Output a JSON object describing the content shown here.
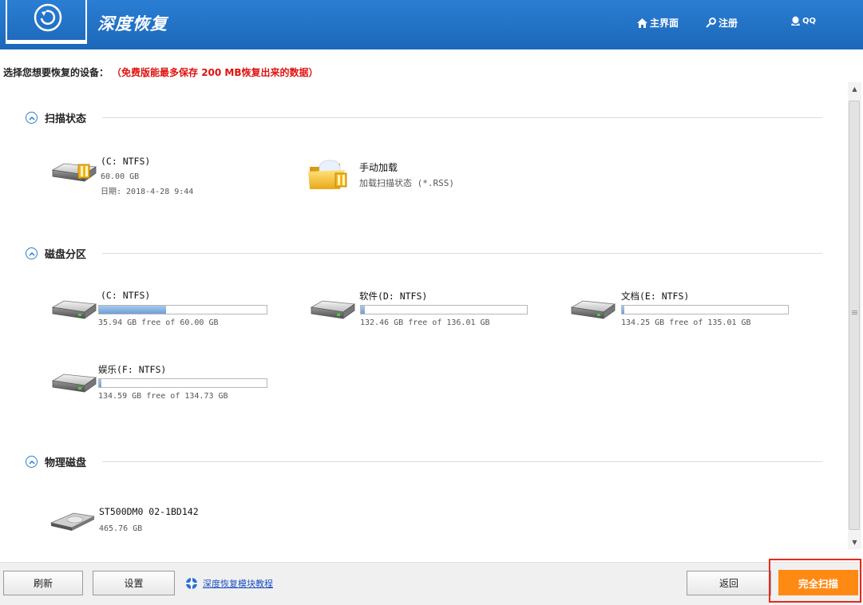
{
  "header": {
    "app_title": "深度恢复",
    "nav": [
      {
        "label": "主界面",
        "icon": "home-icon"
      },
      {
        "label": "注册",
        "icon": "key-icon"
      },
      {
        "label": "QQ",
        "icon": "qq-penguin-icon"
      }
    ]
  },
  "notice": {
    "prompt": "选择您想要恢复的设备：",
    "limit": "（免费版能最多保存 200 MB恢复出来的数据）"
  },
  "sections": {
    "scan_state": {
      "title": "扫描状态",
      "items": [
        {
          "name": "(C: NTFS)",
          "size": "60.00 GB",
          "date": "日期: 2018-4-28 9:44",
          "icon": "hard-drive-lock-icon"
        },
        {
          "name": "手动加载",
          "desc": "加载扫描状态 (*.RSS)",
          "icon": "folder-lock-icon"
        }
      ]
    },
    "partitions": {
      "title": "磁盘分区",
      "items": [
        {
          "name": "(C: NTFS)",
          "free_text": "35.94 GB free of 60.00 GB",
          "used_fraction": 0.401
        },
        {
          "name": "软件(D: NTFS)",
          "free_text": "132.46 GB free of 136.01 GB",
          "used_fraction": 0.026
        },
        {
          "name": "文档(E: NTFS)",
          "free_text": "134.25 GB free of 135.01 GB",
          "used_fraction": 0.006
        },
        {
          "name": "娱乐(F: NTFS)",
          "free_text": "134.59 GB free of 134.73 GB",
          "used_fraction": 0.001
        }
      ]
    },
    "physical": {
      "title": "物理磁盘",
      "items": [
        {
          "name": "ST500DM0 02-1BD142",
          "size": "465.76 GB",
          "icon": "physical-disk-icon"
        }
      ]
    }
  },
  "footer": {
    "refresh": "刷新",
    "settings": "设置",
    "help_link": "深度恢复模块教程",
    "back": "返回",
    "full_scan": "完全扫描"
  },
  "colors": {
    "header_blue": "#1f6fc4",
    "limit_red": "#e0120e",
    "primary_orange": "#ff8a13",
    "highlight_red": "#e8291b",
    "bar_fill": "#6d9fd8"
  }
}
